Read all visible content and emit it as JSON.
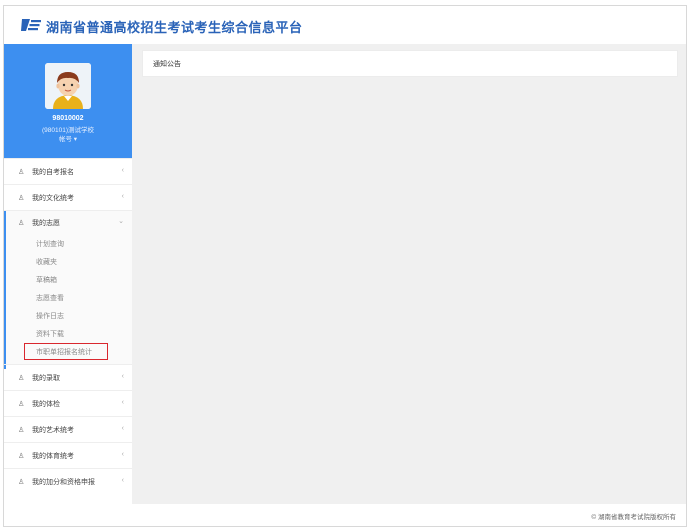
{
  "header": {
    "logo_icon": "exam-platform-logo-icon",
    "title": "湖南省普通高校招生考试考生综合信息平台"
  },
  "sidebar": {
    "profile": {
      "avatar_icon": "student-avatar-icon",
      "user_id": "98010002",
      "school": "(980101)测试学校",
      "action": "帐号 ▾"
    },
    "menu": [
      {
        "label": "我的自考报名",
        "icon": "user-icon",
        "arrow": "‹"
      },
      {
        "label": "我的文化统考",
        "icon": "user-icon",
        "arrow": "‹"
      }
    ],
    "expanded_group": {
      "label": "我的志愿",
      "icon": "user-icon",
      "arrow": "⌄",
      "items": [
        {
          "label": "计划查询"
        },
        {
          "label": "收藏夹"
        },
        {
          "label": "草稿箱"
        },
        {
          "label": "志愿查看"
        },
        {
          "label": "操作日志"
        },
        {
          "label": "资料下载"
        },
        {
          "label": "市职单招报名统计"
        }
      ]
    },
    "menu_after": [
      {
        "label": "我的录取",
        "icon": "user-icon",
        "arrow": "‹"
      },
      {
        "label": "我的体检",
        "icon": "user-icon",
        "arrow": "‹"
      },
      {
        "label": "我的艺术统考",
        "icon": "user-icon",
        "arrow": "‹"
      },
      {
        "label": "我的体育统考",
        "icon": "user-icon",
        "arrow": "‹"
      },
      {
        "label": "我的加分和资格申报",
        "icon": "user-icon",
        "arrow": "‹"
      }
    ]
  },
  "main": {
    "notice_title": "通知公告"
  },
  "footer": {
    "copyright": "© 湖南省教育考试院版权所有"
  },
  "colors": {
    "brand_blue": "#3d8ff0",
    "title_blue": "#2a63b8",
    "highlight_red": "#d9272e"
  }
}
